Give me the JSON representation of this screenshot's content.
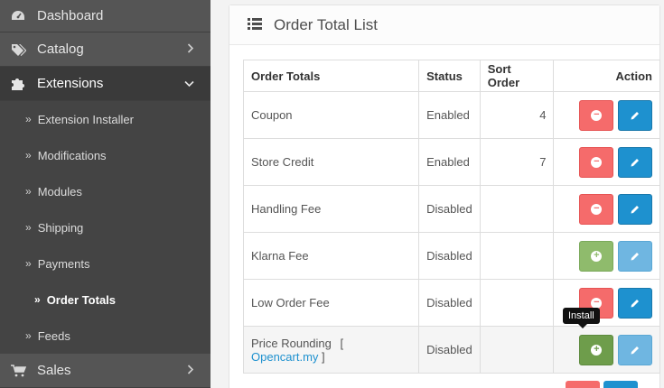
{
  "sidebar": {
    "items": [
      {
        "label": "Dashboard",
        "icon": "dashboard-icon"
      },
      {
        "label": "Catalog",
        "icon": "tags-icon"
      },
      {
        "label": "Extensions",
        "icon": "puzzle-icon"
      }
    ],
    "sub_items": [
      {
        "label": "Extension Installer"
      },
      {
        "label": "Modifications"
      },
      {
        "label": "Modules"
      },
      {
        "label": "Shipping"
      },
      {
        "label": "Payments"
      },
      {
        "label": "Order Totals"
      },
      {
        "label": "Feeds"
      }
    ],
    "sales": {
      "label": "Sales",
      "icon": "cart-icon"
    }
  },
  "panel": {
    "title": "Order Total List",
    "icon": "list-icon"
  },
  "table": {
    "headers": {
      "name": "Order Totals",
      "status": "Status",
      "sort": "Sort Order",
      "action": "Action"
    },
    "rows": [
      {
        "name": "Coupon",
        "status": "Enabled",
        "sort": "4"
      },
      {
        "name": "Store Credit",
        "status": "Enabled",
        "sort": "7"
      },
      {
        "name": "Handling Fee",
        "status": "Disabled",
        "sort": ""
      },
      {
        "name": "Klarna Fee",
        "status": "Disabled",
        "sort": ""
      },
      {
        "name": "Low Order Fee",
        "status": "Disabled",
        "sort": ""
      },
      {
        "name": "Price Rounding",
        "link_open": "[",
        "link": "Opencart.my",
        "link_close": "]",
        "status": "Disabled",
        "sort": ""
      }
    ]
  },
  "tooltip": "Install",
  "colors": {
    "danger": "#f56b6b",
    "primary": "#1e91cf",
    "success": "#8fbb6c",
    "sidebar_bg": "#4a4a4a"
  }
}
